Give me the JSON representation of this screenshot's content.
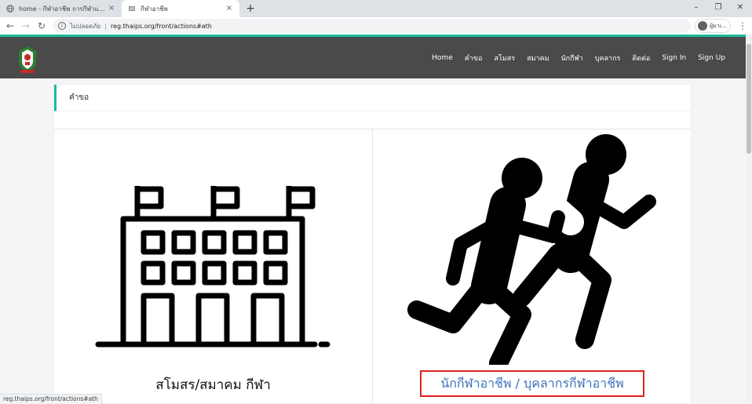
{
  "browser": {
    "tabs": [
      {
        "title": "home - กีฬาอาชีพ การกีฬาแห่งประเทศไทย",
        "icon": "globe-icon"
      },
      {
        "title": "กีฬาอาชีพ",
        "icon": "site-favicon"
      }
    ],
    "omnibox": {
      "security_label": "ไม่ปลอดภัย",
      "url": "reg.thaips.org/front/actions#ath"
    },
    "profile_label": "ผู้มาเ..."
  },
  "site": {
    "nav": [
      "Home",
      "คำขอ",
      "สโมสร",
      "สมาคม",
      "นักกีฬา",
      "บุคลากร",
      "ติดต่อ",
      "Sign In",
      "Sign Up"
    ],
    "panel_title": "คำขอ",
    "cards": [
      {
        "label": "สโมสร/สมาคม กีฬา",
        "icon": "building-icon"
      },
      {
        "label": "นักกีฬาอาชีพ / บุคลากรกีฬาอาชีพ",
        "icon": "runners-icon"
      }
    ]
  },
  "statusbar": {
    "url": "reg.thaips.org/front/actions#ath"
  },
  "colors": {
    "nav_bg": "#4a4a4a",
    "accent": "#1abc9c",
    "link": "#3b73b9",
    "highlight_border": "#e02020"
  }
}
